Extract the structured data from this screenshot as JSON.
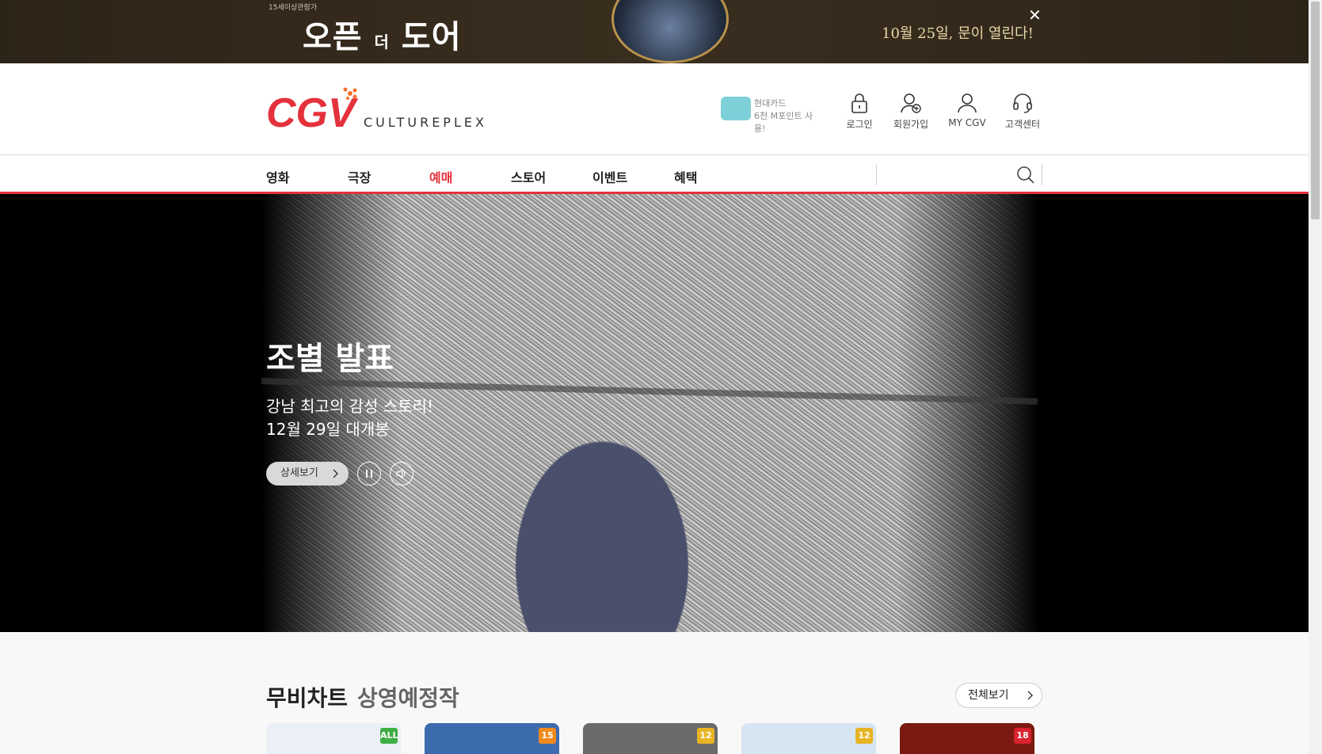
{
  "ad": {
    "rating": "15세이상관람가",
    "title_part1": "오픈",
    "title_part2": "더",
    "title_part3": "도어",
    "date_text": "10월 25일, 문이 열린다!",
    "close_label": "✕"
  },
  "header": {
    "logo_text": "CGV",
    "logo_sub": "CULTUREPLEX",
    "promo_line1": "현대카드",
    "promo_line2": "6천 M포인트 사용!",
    "icons": [
      "로그인",
      "회원가입",
      "MY CGV",
      "고객센터"
    ]
  },
  "nav": {
    "items": [
      "영화",
      "극장",
      "예매",
      "스토어",
      "이벤트",
      "혜택"
    ],
    "active": "예매",
    "search_value": ""
  },
  "hero": {
    "title": "조별 발표",
    "desc1": "강남 최고의 감성 스토리!",
    "desc2": "12월 29일 대개봉",
    "detail_label": "상세보기"
  },
  "movie_chart": {
    "title": "무비차트",
    "subtitle": "상영예정작",
    "view_all": "전체보기",
    "posters": [
      {
        "age": "ALL",
        "age_color": "#3fae45",
        "bg": "#eaf0f6"
      },
      {
        "age": "15",
        "age_color": "#f08a1c",
        "bg": "#3d6cae"
      },
      {
        "age": "12",
        "age_color": "#e7b523",
        "bg": "#6b6b6b"
      },
      {
        "age": "12",
        "age_color": "#e7b523",
        "bg": "#d7e5f3"
      },
      {
        "age": "18",
        "age_color": "#d9232e",
        "bg": "#7a1a10"
      }
    ]
  },
  "colors": {
    "accent": "#e4313c",
    "ad_bg": "#2d2418"
  }
}
